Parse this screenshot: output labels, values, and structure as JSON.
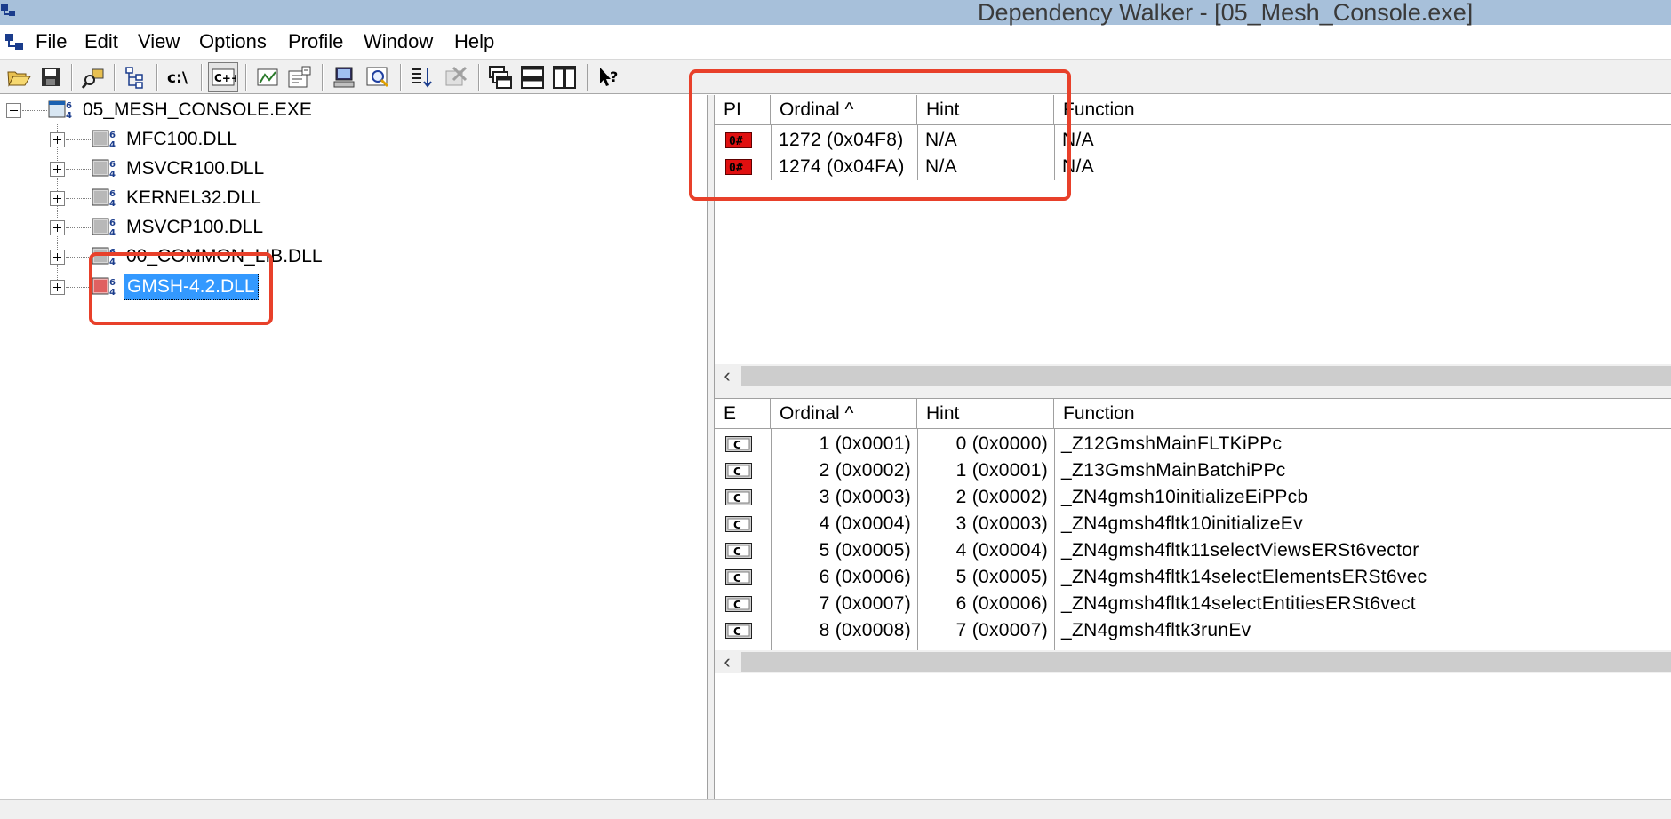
{
  "window": {
    "title": "Dependency Walker - [05_Mesh_Console.exe]"
  },
  "menu": [
    {
      "label": "File"
    },
    {
      "label": "Edit"
    },
    {
      "label": "View"
    },
    {
      "label": "Options"
    },
    {
      "label": "Profile"
    },
    {
      "label": "Window"
    },
    {
      "label": "Help"
    }
  ],
  "toolbar": {
    "buttons": [
      {
        "name": "open-icon"
      },
      {
        "name": "save-icon"
      },
      {
        "name": "copy-icon"
      },
      {
        "name": "view-full-paths-icon"
      },
      {
        "name": "undecorate-cpp-icon",
        "text": "c:\\"
      },
      {
        "name": "cpp-functions-icon",
        "text": "C++",
        "pressed": true
      },
      {
        "name": "highlight-matching-icon"
      },
      {
        "name": "properties-icon"
      },
      {
        "name": "system-information-icon"
      },
      {
        "name": "find-icon"
      },
      {
        "name": "sort-icon"
      },
      {
        "name": "profile-icon"
      },
      {
        "name": "cascade-windows-icon"
      },
      {
        "name": "tile-horizontal-icon"
      },
      {
        "name": "tile-vertical-icon"
      },
      {
        "name": "context-help-icon"
      }
    ]
  },
  "tree": {
    "root": {
      "label": "05_MESH_CONSOLE.EXE"
    },
    "children": [
      {
        "label": "MFC100.DLL",
        "status": "ok"
      },
      {
        "label": "MSVCR100.DLL",
        "status": "ok"
      },
      {
        "label": "KERNEL32.DLL",
        "status": "ok"
      },
      {
        "label": "MSVCP100.DLL",
        "status": "ok"
      },
      {
        "label": "00_COMMON_LIB.DLL",
        "status": "ok"
      },
      {
        "label": "GMSH-4.2.DLL",
        "status": "error",
        "selected": true
      }
    ]
  },
  "imports": {
    "columns": [
      "PI",
      "Ordinal ^",
      "Hint",
      "Function"
    ],
    "rows": [
      {
        "icon": "missing-ordinal-icon",
        "ordinal": "1272 (0x04F8)",
        "hint": "N/A",
        "function": "N/A"
      },
      {
        "icon": "missing-ordinal-icon",
        "ordinal": "1274 (0x04FA)",
        "hint": "N/A",
        "function": "N/A"
      }
    ]
  },
  "exports": {
    "columns": [
      "E",
      "Ordinal ^",
      "Hint",
      "Function"
    ],
    "rows": [
      {
        "icon": "cpp-function-icon",
        "ordinal": "1 (0x0001)",
        "hint": "0 (0x0000)",
        "function": "_Z12GmshMainFLTKiPPc"
      },
      {
        "icon": "cpp-function-icon",
        "ordinal": "2 (0x0002)",
        "hint": "1 (0x0001)",
        "function": "_Z13GmshMainBatchiPPc"
      },
      {
        "icon": "cpp-function-icon",
        "ordinal": "3 (0x0003)",
        "hint": "2 (0x0002)",
        "function": "_ZN4gmsh10initializeEiPPcb"
      },
      {
        "icon": "cpp-function-icon",
        "ordinal": "4 (0x0004)",
        "hint": "3 (0x0003)",
        "function": "_ZN4gmsh4fltk10initializeEv"
      },
      {
        "icon": "cpp-function-icon",
        "ordinal": "5 (0x0005)",
        "hint": "4 (0x0004)",
        "function": "_ZN4gmsh4fltk11selectViewsERSt6vector"
      },
      {
        "icon": "cpp-function-icon",
        "ordinal": "6 (0x0006)",
        "hint": "5 (0x0005)",
        "function": "_ZN4gmsh4fltk14selectElementsERSt6vec"
      },
      {
        "icon": "cpp-function-icon",
        "ordinal": "7 (0x0007)",
        "hint": "6 (0x0006)",
        "function": "_ZN4gmsh4fltk14selectEntitiesERSt6vect"
      },
      {
        "icon": "cpp-function-icon",
        "ordinal": "8 (0x0008)",
        "hint": "7 (0x0007)",
        "function": "_ZN4gmsh4fltk3runEv"
      }
    ]
  },
  "colors": {
    "titlebar": "#a7c0da",
    "selection": "#3399ff",
    "annotation": "#e8402a",
    "error_icon": "#e01010"
  }
}
